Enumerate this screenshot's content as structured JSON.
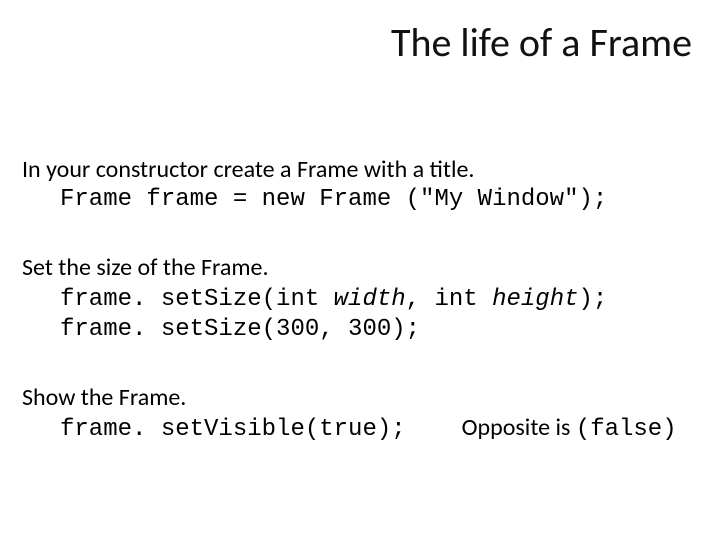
{
  "title": "The life of a Frame",
  "p1": {
    "intro": "In your constructor create a Frame with a title.",
    "code": "Frame frame = new Frame (\"My Window\");"
  },
  "p2": {
    "intro": "Set the size of the Frame.",
    "line1_a": "frame. setSize(int ",
    "line1_b": "width",
    "line1_c": ", int ",
    "line1_d": "height",
    "line1_e": ");",
    "line2": "frame. setSize(300, 300);"
  },
  "p3": {
    "intro": "Show the Frame.",
    "code": "frame. setVisible(true);",
    "opp_label": "Opposite is ",
    "opp_code": "(false)"
  }
}
